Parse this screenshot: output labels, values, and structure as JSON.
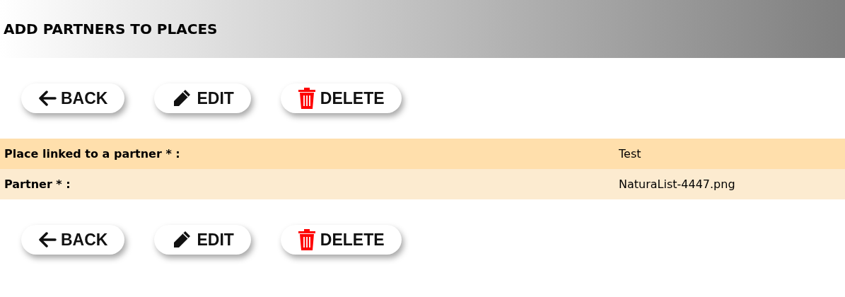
{
  "header": {
    "title": "ADD PARTNERS TO PLACES"
  },
  "top_actions": [
    {
      "kind": "back",
      "label": "BACK"
    },
    {
      "kind": "edit",
      "label": "EDIT"
    },
    {
      "kind": "delete",
      "label": "DELETE"
    }
  ],
  "fields": [
    {
      "label": "Place linked to a partner * :",
      "value": "Test"
    },
    {
      "label": "Partner * :",
      "value": "NaturaList-4447.png"
    }
  ],
  "bottom_actions": [
    {
      "kind": "back",
      "label": "BACK"
    },
    {
      "kind": "edit",
      "label": "EDIT"
    },
    {
      "kind": "delete",
      "label": "DELETE"
    }
  ]
}
